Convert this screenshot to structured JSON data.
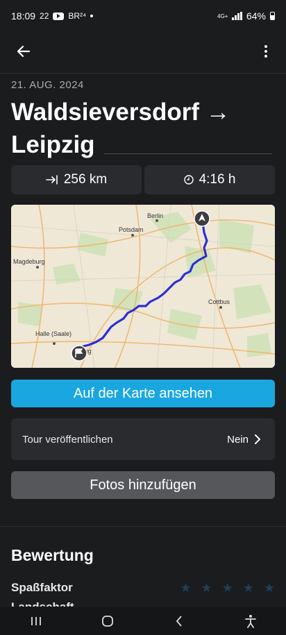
{
  "status_bar": {
    "time": "18:09",
    "notification_count": "22",
    "br_label": "BR²⁴",
    "network": "4G+",
    "battery_percent": "64%"
  },
  "app_bar": {
    "back_icon": "arrow-left-icon",
    "menu_icon": "more-vert-icon"
  },
  "tour": {
    "date": "21. AUG. 2024",
    "title": "Waldsieversdorf → Leipzig",
    "distance": "256 km",
    "duration": "4:16 h",
    "distance_icon": "arrow-to-line-icon",
    "duration_icon": "clock-icon"
  },
  "map": {
    "labels": {
      "berlin": "Berlin",
      "potsdam": "Potsdam",
      "magdeburg": "Magdeburg",
      "cottbus": "Cottbus",
      "halle": "Halle (Saale)",
      "leipzig_partial": "zig"
    },
    "route_color": "#2b2fd6"
  },
  "actions": {
    "view_on_map": "Auf der Karte ansehen",
    "publish_label": "Tour veröffentlichen",
    "publish_value": "Nein",
    "add_photos": "Fotos hinzufügen"
  },
  "rating": {
    "title": "Bewertung",
    "fun_label": "Spaßfaktor",
    "second_label": "Landschaft",
    "fun_stars": 0,
    "max_stars": 5
  },
  "colors": {
    "background": "#1b1c1e",
    "card": "#2a2b2e",
    "primary": "#1aa7e0",
    "secondary": "#55575b"
  }
}
